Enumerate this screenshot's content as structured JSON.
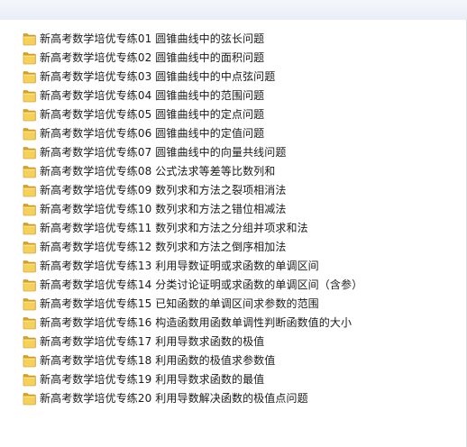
{
  "files": [
    {
      "name": "新高考数学培优专练01 圆锥曲线中的弦长问题",
      "icon": "folder-icon"
    },
    {
      "name": "新高考数学培优专练02 圆锥曲线中的面积问题",
      "icon": "folder-icon"
    },
    {
      "name": "新高考数学培优专练03 圆锥曲线中的中点弦问题",
      "icon": "folder-icon"
    },
    {
      "name": "新高考数学培优专练04 圆锥曲线中的范围问题",
      "icon": "folder-icon"
    },
    {
      "name": "新高考数学培优专练05 圆锥曲线中的定点问题",
      "icon": "folder-icon"
    },
    {
      "name": "新高考数学培优专练06 圆锥曲线中的定值问题",
      "icon": "folder-icon"
    },
    {
      "name": "新高考数学培优专练07 圆锥曲线中的向量共线问题",
      "icon": "folder-icon"
    },
    {
      "name": "新高考数学培优专练08 公式法求等差等比数列和",
      "icon": "folder-icon"
    },
    {
      "name": "新高考数学培优专练09 数列求和方法之裂项相消法",
      "icon": "folder-icon"
    },
    {
      "name": "新高考数学培优专练10 数列求和方法之错位相减法",
      "icon": "folder-icon"
    },
    {
      "name": "新高考数学培优专练11 数列求和方法之分组并项求和法",
      "icon": "folder-icon"
    },
    {
      "name": "新高考数学培优专练12 数列求和方法之倒序相加法",
      "icon": "folder-icon"
    },
    {
      "name": "新高考数学培优专练13 利用导数证明或求函数的单调区间",
      "icon": "folder-icon"
    },
    {
      "name": "新高考数学培优专练14 分类讨论证明或求函数的单调区间（含参）",
      "icon": "folder-icon"
    },
    {
      "name": "新高考数学培优专练15 已知函数的单调区间求参数的范围",
      "icon": "folder-icon"
    },
    {
      "name": "新高考数学培优专练16 构造函数用函数单调性判断函数值的大小",
      "icon": "folder-icon"
    },
    {
      "name": "新高考数学培优专练17 利用导数求函数的极值",
      "icon": "folder-icon"
    },
    {
      "name": "新高考数学培优专练18 利用函数的极值求参数值",
      "icon": "folder-icon"
    },
    {
      "name": "新高考数学培优专练19 利用导数求函数的最值",
      "icon": "folder-icon"
    },
    {
      "name": "新高考数学培优专练20 利用导数解决函数的极值点问题",
      "icon": "folder-icon"
    }
  ],
  "colors": {
    "folder_back": "#d9a21a",
    "folder_front": "#f6d15a",
    "folder_edge": "#b9861a",
    "text": "#1a1a1a"
  }
}
